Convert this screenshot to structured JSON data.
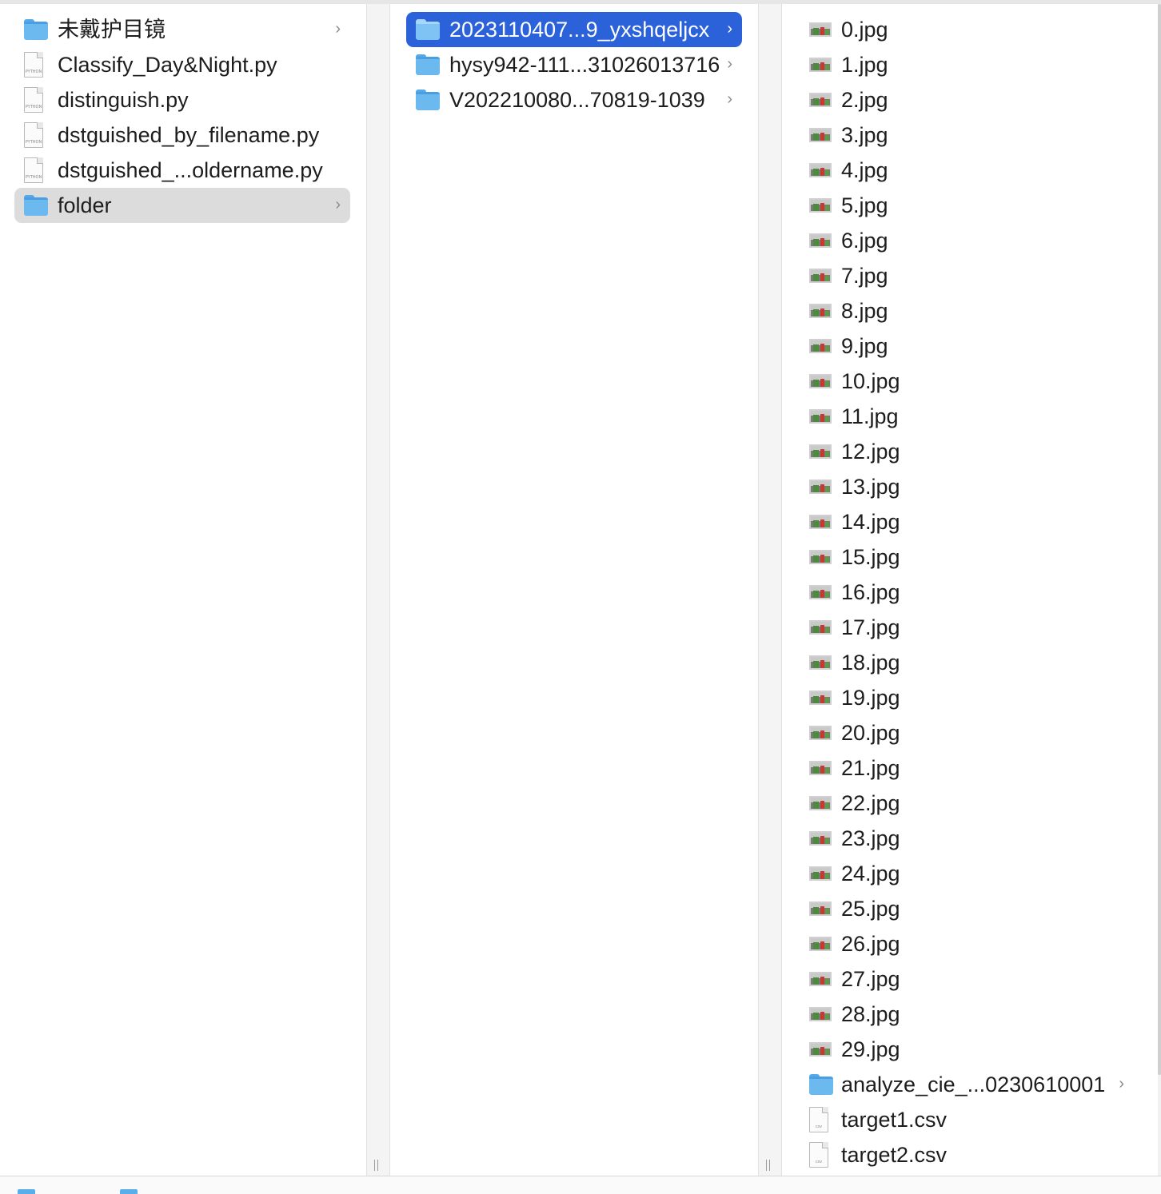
{
  "column1": {
    "items": [
      {
        "label": "未戴护目镜",
        "icon": "folder-icon",
        "has_children": true
      },
      {
        "label": "Classify_Day&Night.py",
        "icon": "python-file-icon",
        "has_children": false
      },
      {
        "label": "distinguish.py",
        "icon": "python-file-icon",
        "has_children": false
      },
      {
        "label": "dstguished_by_filename.py",
        "icon": "python-file-icon",
        "has_children": false
      },
      {
        "label": "dstguished_...oldername.py",
        "icon": "python-file-icon",
        "has_children": false
      },
      {
        "label": "folder",
        "icon": "folder-icon",
        "has_children": true,
        "selected": true
      }
    ]
  },
  "column2": {
    "items": [
      {
        "label": "2023110407...9_yxshqeljcx",
        "icon": "folder-icon",
        "has_children": true,
        "selected": true
      },
      {
        "label": "hysy942-111...31026013716",
        "icon": "folder-icon",
        "has_children": true
      },
      {
        "label": "V202210080...70819-1039",
        "icon": "folder-icon",
        "has_children": true
      }
    ]
  },
  "column3": {
    "items": [
      {
        "label": "0.jpg",
        "icon": "image-file-icon"
      },
      {
        "label": "1.jpg",
        "icon": "image-file-icon"
      },
      {
        "label": "2.jpg",
        "icon": "image-file-icon"
      },
      {
        "label": "3.jpg",
        "icon": "image-file-icon"
      },
      {
        "label": "4.jpg",
        "icon": "image-file-icon"
      },
      {
        "label": "5.jpg",
        "icon": "image-file-icon"
      },
      {
        "label": "6.jpg",
        "icon": "image-file-icon"
      },
      {
        "label": "7.jpg",
        "icon": "image-file-icon"
      },
      {
        "label": "8.jpg",
        "icon": "image-file-icon"
      },
      {
        "label": "9.jpg",
        "icon": "image-file-icon"
      },
      {
        "label": "10.jpg",
        "icon": "image-file-icon"
      },
      {
        "label": "11.jpg",
        "icon": "image-file-icon"
      },
      {
        "label": "12.jpg",
        "icon": "image-file-icon"
      },
      {
        "label": "13.jpg",
        "icon": "image-file-icon"
      },
      {
        "label": "14.jpg",
        "icon": "image-file-icon"
      },
      {
        "label": "15.jpg",
        "icon": "image-file-icon"
      },
      {
        "label": "16.jpg",
        "icon": "image-file-icon"
      },
      {
        "label": "17.jpg",
        "icon": "image-file-icon"
      },
      {
        "label": "18.jpg",
        "icon": "image-file-icon"
      },
      {
        "label": "19.jpg",
        "icon": "image-file-icon"
      },
      {
        "label": "20.jpg",
        "icon": "image-file-icon"
      },
      {
        "label": "21.jpg",
        "icon": "image-file-icon"
      },
      {
        "label": "22.jpg",
        "icon": "image-file-icon"
      },
      {
        "label": "23.jpg",
        "icon": "image-file-icon"
      },
      {
        "label": "24.jpg",
        "icon": "image-file-icon"
      },
      {
        "label": "25.jpg",
        "icon": "image-file-icon"
      },
      {
        "label": "26.jpg",
        "icon": "image-file-icon"
      },
      {
        "label": "27.jpg",
        "icon": "image-file-icon"
      },
      {
        "label": "28.jpg",
        "icon": "image-file-icon"
      },
      {
        "label": "29.jpg",
        "icon": "image-file-icon"
      },
      {
        "label": "analyze_cie_...0230610001",
        "icon": "folder-icon",
        "has_children": true
      },
      {
        "label": "target1.csv",
        "icon": "csv-file-icon"
      },
      {
        "label": "target2.csv",
        "icon": "csv-file-icon"
      }
    ]
  },
  "colors": {
    "selection_blue": "#2b62d9",
    "selection_gray": "#dcdcdc",
    "folder_blue": "#6cb9f0"
  }
}
